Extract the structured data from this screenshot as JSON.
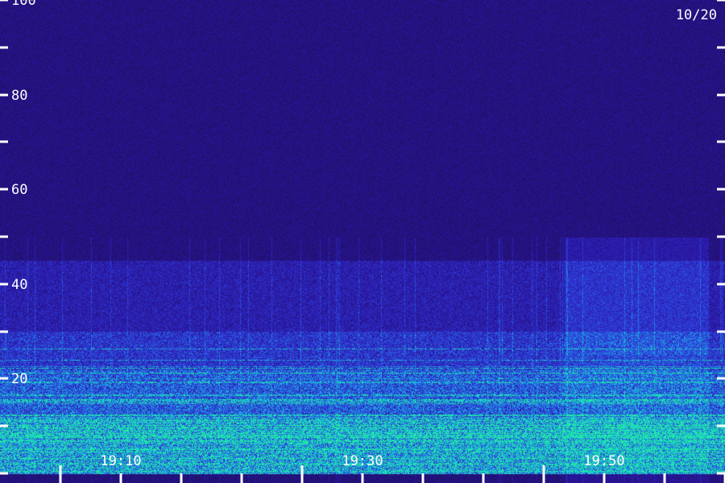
{
  "date_label": "10/20",
  "chart_data": {
    "type": "heatmap",
    "title": "",
    "xlabel": "",
    "ylabel": "",
    "x_range": [
      "19:05",
      "20:05"
    ],
    "x_tick_labels": [
      "19:10",
      "19:30",
      "19:50"
    ],
    "ylim": [
      0,
      102
    ],
    "y_tick_labels": [
      "20",
      "40",
      "60",
      "80",
      "100"
    ],
    "y_tick_values": [
      20,
      40,
      60,
      80,
      100
    ],
    "y_minor_tick_values": [
      0,
      10,
      30,
      50,
      70,
      90
    ],
    "colormap": [
      "#1b0d4a",
      "#2a16a0",
      "#2f3fe0",
      "#1ab0e8",
      "#20f0a0"
    ],
    "intensity_bands": [
      {
        "y_from": 0,
        "y_to": 12,
        "level": 0.85
      },
      {
        "y_from": 12,
        "y_to": 22,
        "level": 0.6
      },
      {
        "y_from": 22,
        "y_to": 30,
        "level": 0.45
      },
      {
        "y_from": 30,
        "y_to": 45,
        "level": 0.3
      },
      {
        "y_from": 45,
        "y_to": 102,
        "level": 0.12
      }
    ]
  }
}
